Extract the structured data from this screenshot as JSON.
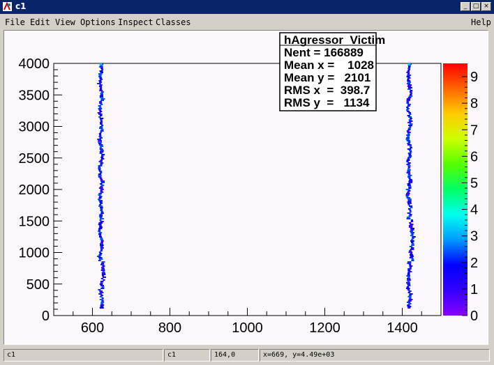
{
  "window": {
    "title": "c1",
    "minimize": "_",
    "maximize": "□",
    "close": "×"
  },
  "menu": {
    "file": "File",
    "edit": "Edit",
    "view": "View",
    "options": "Options",
    "inspect": "Inspect",
    "classes": "Classes",
    "help": "Help"
  },
  "chart_data": {
    "type": "heatmap",
    "title": "",
    "xlabel": "",
    "ylabel": "",
    "xlim": [
      500,
      1500
    ],
    "ylim": [
      0,
      4000
    ],
    "x_ticks": [
      "600",
      "800",
      "1000",
      "1200",
      "1400"
    ],
    "y_ticks": [
      "0",
      "500",
      "1000",
      "1500",
      "2000",
      "2500",
      "3000",
      "3500",
      "4000"
    ],
    "z_ticks": [
      "0",
      "1",
      "2",
      "3",
      "4",
      "5",
      "6",
      "7",
      "8",
      "9"
    ],
    "zlim": [
      0,
      9.5
    ],
    "bands": [
      {
        "x_center": 622,
        "y_range": [
          130,
          4000
        ],
        "dominant_count": 2
      },
      {
        "x_center": 1418,
        "y_range": [
          130,
          4000
        ],
        "dominant_count": 2
      }
    ],
    "stats": {
      "name": "hAgressor_Victim",
      "entries_label": "Nent = 166889",
      "mean_x_label": "Mean x =    1028",
      "mean_y_label": "Mean y =   2101",
      "rms_x_label": "RMS x  =  398.7",
      "rms_y_label": "RMS y  =   1134"
    }
  },
  "status": {
    "s1": "c1",
    "s2": "c1",
    "s3": "164,0",
    "s4": "x=669, y=4.49e+03"
  }
}
